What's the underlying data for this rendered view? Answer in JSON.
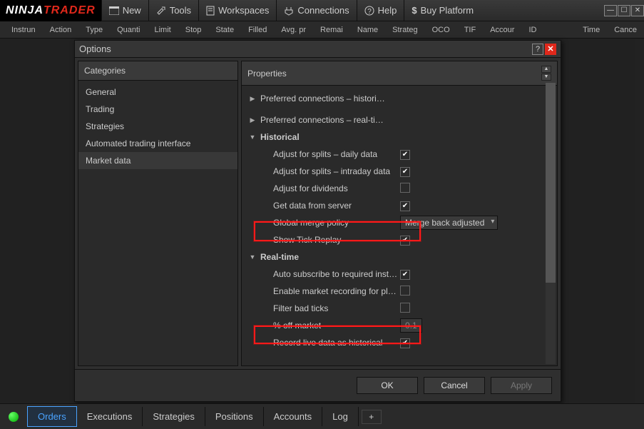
{
  "logo": {
    "part1": "NINJA",
    "part2": "TRADER"
  },
  "menu": {
    "new": "New",
    "tools": "Tools",
    "workspaces": "Workspaces",
    "connections": "Connections",
    "help": "Help",
    "buy": "Buy Platform"
  },
  "columns": [
    "Instrun",
    "Action",
    "Type",
    "Quanti",
    "Limit",
    "Stop",
    "State",
    "Filled",
    "Avg. pr",
    "Remai",
    "Name",
    "Strateg",
    "OCO",
    "TIF",
    "Accour",
    "ID",
    "Time",
    "Cance"
  ],
  "dialog": {
    "title": "Options",
    "categories_label": "Categories",
    "properties_label": "Properties",
    "categories": [
      "General",
      "Trading",
      "Strategies",
      "Automated trading interface",
      "Market data"
    ],
    "selected_category": "Market data",
    "pref_hist": "Preferred connections – histori…",
    "pref_rt": "Preferred connections – real-ti…",
    "sect_hist": "Historical",
    "adjust_daily": "Adjust for splits – daily data",
    "adjust_intraday": "Adjust for splits – intraday data",
    "adjust_div": "Adjust for dividends",
    "get_data": "Get data from server",
    "global_merge": "Global merge policy",
    "global_merge_val": "Merge back adjusted",
    "show_tick": "Show Tick Replay",
    "sect_rt": "Real-time",
    "auto_sub": "Auto subscribe to required inst…",
    "enable_rec": "Enable market recording for pl…",
    "filter_bad": "Filter bad ticks",
    "pct_off": "% off market",
    "pct_off_val": "0.1",
    "record_live": "Record live data as historical",
    "ok": "OK",
    "cancel": "Cancel",
    "apply": "Apply"
  },
  "tabs": {
    "orders": "Orders",
    "executions": "Executions",
    "strategies": "Strategies",
    "positions": "Positions",
    "accounts": "Accounts",
    "log": "Log"
  }
}
